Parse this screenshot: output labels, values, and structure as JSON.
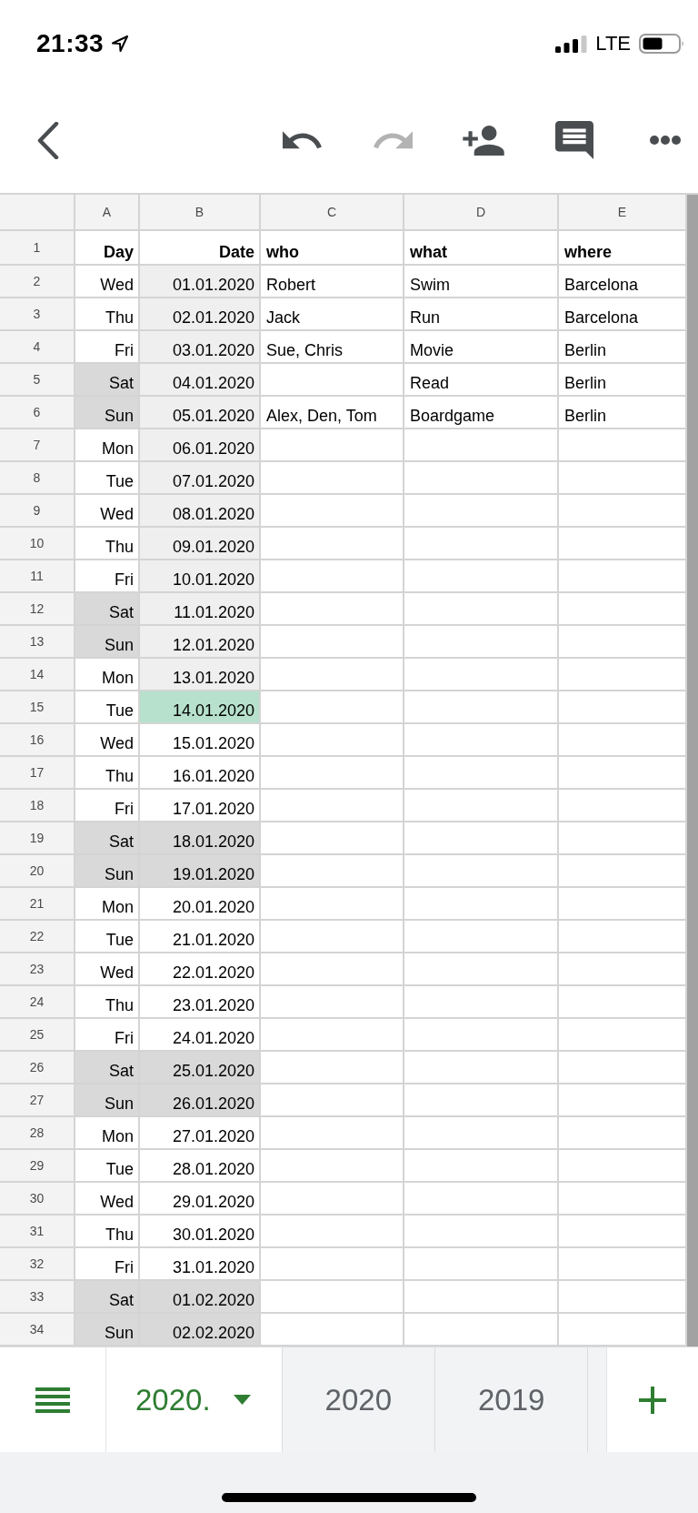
{
  "status_bar": {
    "time": "21:33",
    "network": "LTE"
  },
  "toolbar": {
    "undo": {
      "disabled": false
    },
    "redo": {
      "disabled": true
    }
  },
  "columns": [
    "A",
    "B",
    "C",
    "D",
    "E"
  ],
  "rows": [
    {
      "number": "1",
      "kind": "heading",
      "cells": [
        {
          "text": "Day"
        },
        {
          "text": "Date"
        },
        {
          "text": "who"
        },
        {
          "text": "what"
        },
        {
          "text": "where"
        }
      ]
    },
    {
      "number": "2",
      "kind": "data",
      "cells": [
        {
          "text": "Wed"
        },
        {
          "text": "01.01.2020",
          "color": "#efefef"
        },
        {
          "text": "Robert"
        },
        {
          "text": "Swim"
        },
        {
          "text": "Barcelona"
        }
      ]
    },
    {
      "number": "3",
      "kind": "data",
      "cells": [
        {
          "text": "Thu"
        },
        {
          "text": "02.01.2020",
          "color": "#efefef"
        },
        {
          "text": "Jack"
        },
        {
          "text": "Run"
        },
        {
          "text": "Barcelona"
        }
      ]
    },
    {
      "number": "4",
      "kind": "data",
      "cells": [
        {
          "text": "Fri"
        },
        {
          "text": "03.01.2020",
          "color": "#efefef"
        },
        {
          "text": "Sue, Chris"
        },
        {
          "text": "Movie"
        },
        {
          "text": "Berlin"
        }
      ]
    },
    {
      "number": "5",
      "kind": "data",
      "cells": [
        {
          "text": "Sat",
          "color": "#d9d9d9"
        },
        {
          "text": "04.01.2020",
          "color": "#efefef"
        },
        {},
        {
          "text": "Read"
        },
        {
          "text": "Berlin"
        }
      ]
    },
    {
      "number": "6",
      "kind": "data",
      "cells": [
        {
          "text": "Sun",
          "color": "#d9d9d9"
        },
        {
          "text": "05.01.2020",
          "color": "#efefef"
        },
        {
          "text": "Alex, Den, Tom"
        },
        {
          "text": "Boardgame"
        },
        {
          "text": "Berlin"
        }
      ]
    },
    {
      "number": "7",
      "kind": "data",
      "cells": [
        {
          "text": "Mon"
        },
        {
          "text": "06.01.2020",
          "color": "#efefef"
        }
      ]
    },
    {
      "number": "8",
      "kind": "data",
      "cells": [
        {
          "text": "Tue"
        },
        {
          "text": "07.01.2020",
          "color": "#efefef"
        }
      ]
    },
    {
      "number": "9",
      "kind": "data",
      "cells": [
        {
          "text": "Wed"
        },
        {
          "text": "08.01.2020",
          "color": "#efefef"
        }
      ]
    },
    {
      "number": "10",
      "kind": "data",
      "cells": [
        {
          "text": "Thu"
        },
        {
          "text": "09.01.2020",
          "color": "#efefef"
        }
      ]
    },
    {
      "number": "11",
      "kind": "data",
      "cells": [
        {
          "text": "Fri"
        },
        {
          "text": "10.01.2020",
          "color": "#efefef"
        }
      ]
    },
    {
      "number": "12",
      "kind": "data",
      "cells": [
        {
          "text": "Sat",
          "color": "#d9d9d9"
        },
        {
          "text": "11.01.2020",
          "color": "#efefef"
        }
      ]
    },
    {
      "number": "13",
      "kind": "data",
      "cells": [
        {
          "text": "Sun",
          "color": "#d9d9d9"
        },
        {
          "text": "12.01.2020",
          "color": "#efefef"
        }
      ]
    },
    {
      "number": "14",
      "kind": "data",
      "cells": [
        {
          "text": "Mon"
        },
        {
          "text": "13.01.2020",
          "color": "#efefef"
        }
      ]
    },
    {
      "number": "15",
      "kind": "data",
      "cells": [
        {
          "text": "Tue"
        },
        {
          "text": "14.01.2020",
          "color": "#b7e1cd"
        }
      ]
    },
    {
      "number": "16",
      "kind": "data",
      "cells": [
        {
          "text": "Wed"
        },
        {
          "text": "15.01.2020"
        }
      ]
    },
    {
      "number": "17",
      "kind": "data",
      "cells": [
        {
          "text": "Thu"
        },
        {
          "text": "16.01.2020"
        }
      ]
    },
    {
      "number": "18",
      "kind": "data",
      "cells": [
        {
          "text": "Fri"
        },
        {
          "text": "17.01.2020"
        }
      ]
    },
    {
      "number": "19",
      "kind": "data",
      "cells": [
        {
          "text": "Sat",
          "color": "#d9d9d9"
        },
        {
          "text": "18.01.2020",
          "color": "#d9d9d9"
        }
      ]
    },
    {
      "number": "20",
      "kind": "data",
      "cells": [
        {
          "text": "Sun",
          "color": "#d9d9d9"
        },
        {
          "text": "19.01.2020",
          "color": "#d9d9d9"
        }
      ]
    },
    {
      "number": "21",
      "kind": "data",
      "cells": [
        {
          "text": "Mon"
        },
        {
          "text": "20.01.2020"
        }
      ]
    },
    {
      "number": "22",
      "kind": "data",
      "cells": [
        {
          "text": "Tue"
        },
        {
          "text": "21.01.2020"
        }
      ]
    },
    {
      "number": "23",
      "kind": "data",
      "cells": [
        {
          "text": "Wed"
        },
        {
          "text": "22.01.2020"
        }
      ]
    },
    {
      "number": "24",
      "kind": "data",
      "cells": [
        {
          "text": "Thu"
        },
        {
          "text": "23.01.2020"
        }
      ]
    },
    {
      "number": "25",
      "kind": "data",
      "cells": [
        {
          "text": "Fri"
        },
        {
          "text": "24.01.2020"
        }
      ]
    },
    {
      "number": "26",
      "kind": "data",
      "cells": [
        {
          "text": "Sat",
          "color": "#d9d9d9"
        },
        {
          "text": "25.01.2020",
          "color": "#d9d9d9"
        }
      ]
    },
    {
      "number": "27",
      "kind": "data",
      "cells": [
        {
          "text": "Sun",
          "color": "#d9d9d9"
        },
        {
          "text": "26.01.2020",
          "color": "#d9d9d9"
        }
      ]
    },
    {
      "number": "28",
      "kind": "data",
      "cells": [
        {
          "text": "Mon"
        },
        {
          "text": "27.01.2020"
        }
      ]
    },
    {
      "number": "29",
      "kind": "data",
      "cells": [
        {
          "text": "Tue"
        },
        {
          "text": "28.01.2020"
        }
      ]
    },
    {
      "number": "30",
      "kind": "data",
      "cells": [
        {
          "text": "Wed"
        },
        {
          "text": "29.01.2020"
        }
      ]
    },
    {
      "number": "31",
      "kind": "data",
      "cells": [
        {
          "text": "Thu"
        },
        {
          "text": "30.01.2020"
        }
      ]
    },
    {
      "number": "32",
      "kind": "data",
      "cells": [
        {
          "text": "Fri"
        },
        {
          "text": "31.01.2020"
        }
      ]
    },
    {
      "number": "33",
      "kind": "data",
      "cells": [
        {
          "text": "Sat",
          "color": "#d9d9d9"
        },
        {
          "text": "01.02.2020",
          "color": "#d9d9d9"
        }
      ]
    },
    {
      "number": "34",
      "kind": "data",
      "cells": [
        {
          "text": "Sun",
          "color": "#d9d9d9"
        },
        {
          "text": "02.02.2020",
          "color": "#d9d9d9"
        }
      ]
    }
  ],
  "sheet_tabs": [
    {
      "label": "2020.",
      "selected": true
    },
    {
      "label": "2020",
      "selected": false
    },
    {
      "label": "2019",
      "selected": false
    }
  ]
}
